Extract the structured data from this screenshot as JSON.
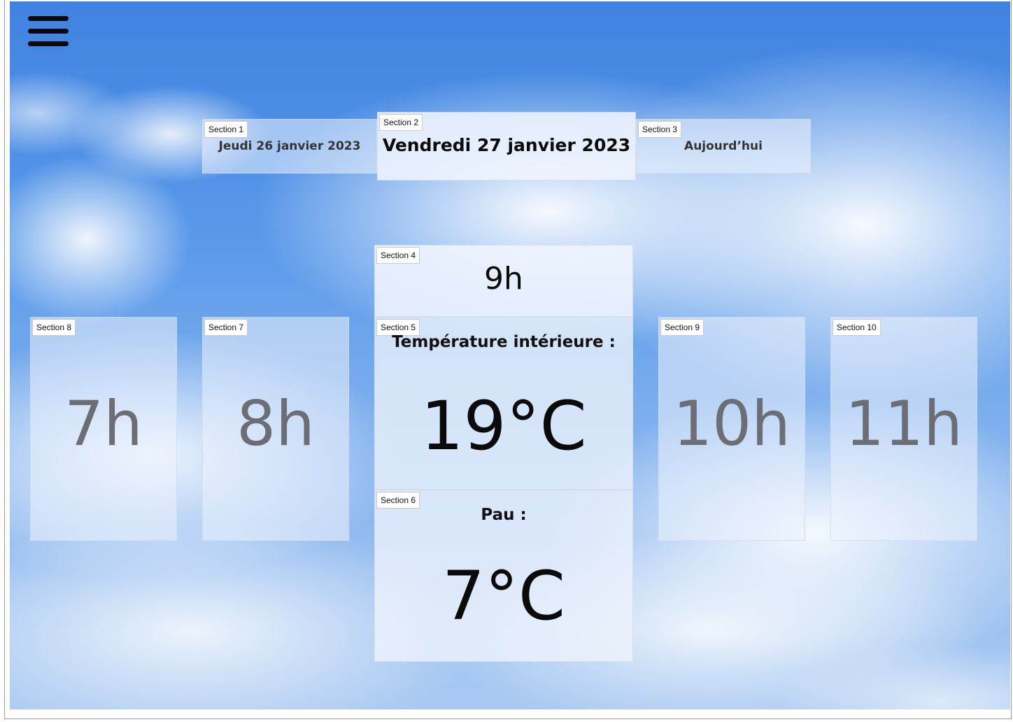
{
  "header": {
    "menu_icon": "hamburger-menu-icon"
  },
  "days": {
    "previous": {
      "section": "Section 1",
      "label": "Jeudi 26 janvier 2023"
    },
    "current": {
      "section": "Section 2",
      "label": "Vendredi 27 janvier 2023"
    },
    "next": {
      "section": "Section 3",
      "label": "Aujourd’hui"
    }
  },
  "current_hour": {
    "section": "Section 4",
    "label": "9h"
  },
  "indoor": {
    "section": "Section 5",
    "label": "Température intérieure :",
    "value": "19°C"
  },
  "outdoor": {
    "section": "Section 6",
    "label": "Pau :",
    "value": "7°C"
  },
  "hours": {
    "h7": {
      "section": "Section 8",
      "label": "7h"
    },
    "h8": {
      "section": "Section 7",
      "label": "8h"
    },
    "h10": {
      "section": "Section 9",
      "label": "10h"
    },
    "h11": {
      "section": "Section 10",
      "label": "11h"
    }
  },
  "colors": {
    "sky_top": "#3f82e0",
    "sky_bottom": "#a9c9f1",
    "hour_text": "#6b6f75",
    "card_bg": "#eef4fd"
  }
}
